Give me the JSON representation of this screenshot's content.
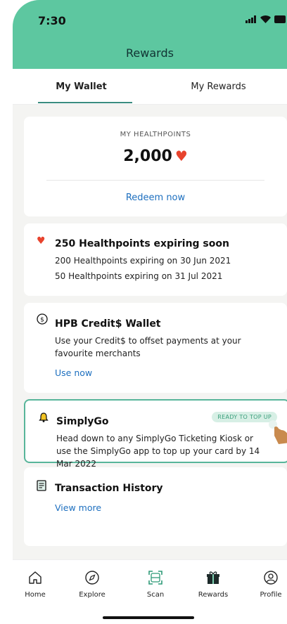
{
  "status": {
    "time": "7:30"
  },
  "header": {
    "title": "Rewards"
  },
  "tabs": [
    {
      "label": "My Wallet"
    },
    {
      "label": "My Rewards"
    }
  ],
  "healthpoints": {
    "label": "MY HEALTHPOINTS",
    "value": "2,000",
    "redeem": "Redeem now"
  },
  "expiring": {
    "title": "250 Healthpoints expiring soon",
    "lines": [
      "200 Healthpoints expiring on 30 Jun 2021",
      "50 Healthpoints expiring on 31 Jul 2021"
    ]
  },
  "credit": {
    "title": "HPB Credit$ Wallet",
    "lines": [
      "Use your Credit$ to offset payments at your",
      "favourite merchants"
    ],
    "link": "Use now"
  },
  "simplygo": {
    "title": "SimplyGo",
    "badge": "READY TO TOP UP",
    "lines": [
      "Head down to any SimplyGo Ticketing Kiosk or",
      "use the SimplyGo app to top up your card by 14",
      "Mar 2022"
    ]
  },
  "transactions": {
    "title": "Transaction History",
    "link": "View more"
  },
  "nav": [
    {
      "label": "Home",
      "icon": "home-icon"
    },
    {
      "label": "Explore",
      "icon": "compass-icon"
    },
    {
      "label": "Scan",
      "icon": "scan-icon"
    },
    {
      "label": "Rewards",
      "icon": "gift-icon"
    },
    {
      "label": "Profile",
      "icon": "profile-icon"
    }
  ],
  "colors": {
    "header": "#5dc7a0",
    "link": "#1d6fbf",
    "accent": "#3a8c80",
    "heart": "#e8432d"
  }
}
